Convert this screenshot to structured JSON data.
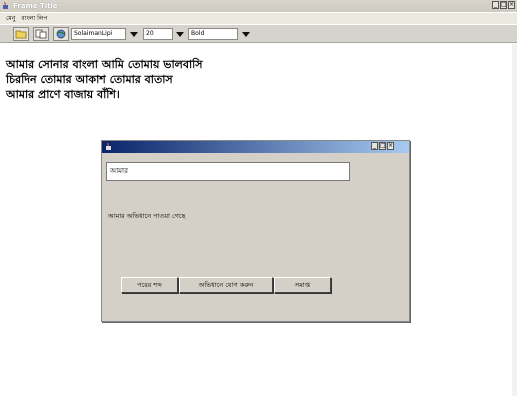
{
  "window": {
    "title": "Frame Title",
    "buttons": [
      "_",
      "□",
      "×"
    ]
  },
  "menubar": {
    "items": [
      "মেনু",
      "বাংলা লিপ"
    ]
  },
  "toolbar": {
    "font": "SolaimanLipi",
    "size": "20",
    "style": "Bold"
  },
  "editor": {
    "lines": [
      "আমার সোনার বাংলা আমি তোমায় ভালবাসি",
      "চিরদিন তোমার আকাশ তোমার বাতাস",
      "আমার প্রাণে বাজায় বাঁশি।"
    ]
  },
  "dialog": {
    "input_value": "আমার",
    "message": "আমার অভিধানে পাওয়া গেছে",
    "buttons": {
      "next": "পরের শব্দ",
      "add": "অভিধানে যোগ করুন",
      "done": "সমাপ্ত"
    }
  },
  "colors": {
    "dialog_title_start": "#0a246a",
    "dialog_title_end": "#a6caf0",
    "window_bg": "#d4d0c8"
  }
}
